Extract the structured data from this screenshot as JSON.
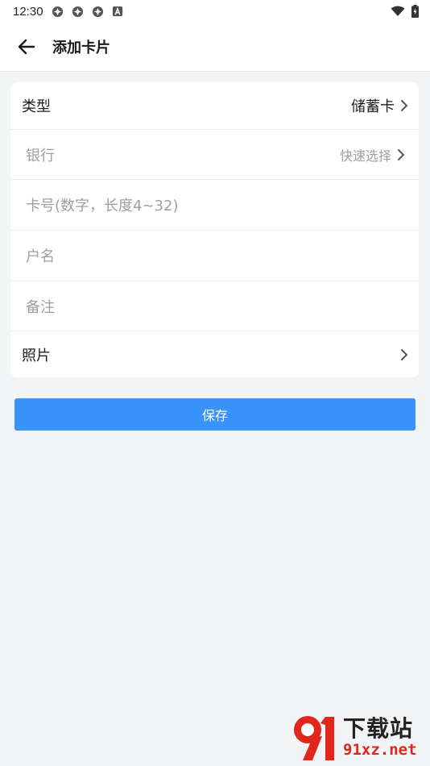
{
  "status_bar": {
    "time": "12:30",
    "left_icons": [
      "sync-icon",
      "sync-icon",
      "sync-icon",
      "a-badge-icon"
    ],
    "right_icons": [
      "wifi-icon",
      "battery-icon"
    ]
  },
  "app_bar": {
    "title": "添加卡片",
    "back_icon": "arrow-left-icon"
  },
  "form": {
    "type": {
      "label": "类型",
      "value": "储蓄卡"
    },
    "bank": {
      "placeholder": "银行",
      "hint": "快速选择"
    },
    "card_number": {
      "placeholder": "卡号(数字，长度4~32)"
    },
    "account_name": {
      "placeholder": "户名"
    },
    "note": {
      "placeholder": "备注"
    },
    "photo": {
      "label": "照片"
    }
  },
  "save_button": {
    "label": "保存"
  },
  "watermark": {
    "cn": "下载站",
    "en": "91xz.net"
  },
  "colors": {
    "primary": "#3a92fb",
    "background": "#f3f4f6",
    "placeholder": "#9aa0a6"
  }
}
